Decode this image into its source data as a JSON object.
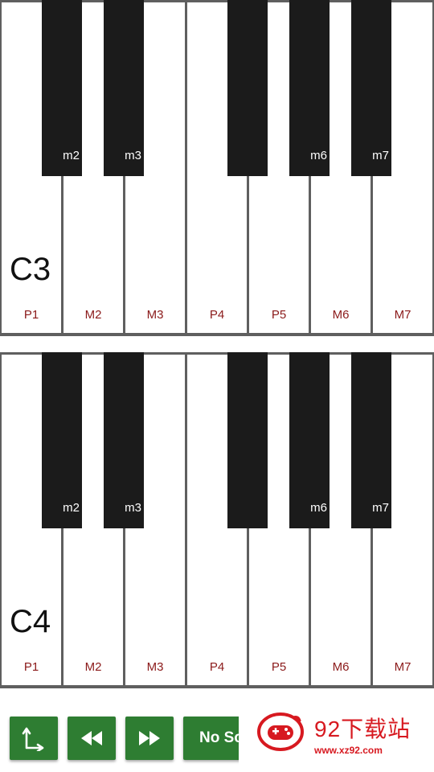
{
  "octaves": [
    {
      "name": "C3",
      "white_keys": [
        "P1",
        "M2",
        "M3",
        "P4",
        "P5",
        "M6",
        "M7"
      ],
      "black_keys": [
        "m2",
        "m3",
        "",
        "m6",
        "m7"
      ]
    },
    {
      "name": "C4",
      "white_keys": [
        "P1",
        "M2",
        "M3",
        "P4",
        "P5",
        "M6",
        "M7"
      ],
      "black_keys": [
        "m2",
        "m3",
        "",
        "m6",
        "m7"
      ]
    }
  ],
  "toolbar": {
    "sound_label": "No Sound"
  },
  "watermark": {
    "title": "92下载站",
    "url": "www.xz92.com"
  },
  "colors": {
    "button_green": "#2e7d32",
    "interval_label": "#8b1a1a",
    "black_key": "#1b1b1b",
    "watermark_red": "#d71920"
  },
  "icons": [
    "direction-arrow-icon",
    "rewind-icon",
    "fast-forward-icon",
    "gamepad-logo-icon"
  ]
}
